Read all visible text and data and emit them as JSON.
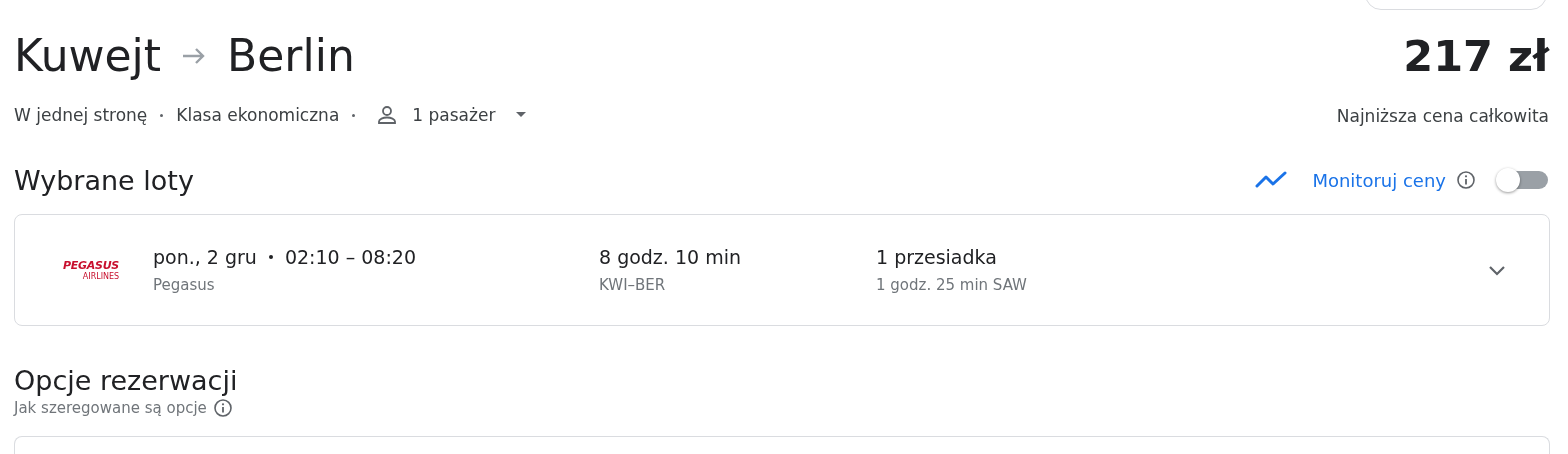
{
  "trip": {
    "origin": "Kuwejt",
    "destination": "Berlin",
    "price": "217 zł",
    "price_note": "Najniższa cena całkowita",
    "options": [
      "W jednej stronę",
      "Klasa ekonomiczna"
    ],
    "passengers": "1 pasażer"
  },
  "selected_flights": {
    "title": "Wybrane loty",
    "track_prices": {
      "label": "Monitoruj ceny",
      "on": false
    }
  },
  "flights": [
    {
      "logo": "PEGASUS",
      "logo_sub": "AIRLINES",
      "date": "pon., 2 gru",
      "times": "02:10 – 08:20",
      "airline": "Pegasus",
      "duration": "8 godz. 10 min",
      "route": "KWI–BER",
      "stops": "1 przesiadka",
      "layover": "1 godz. 25 min SAW",
      "expanded": false
    }
  ],
  "booking": {
    "title": "Opcje rezerwacji",
    "subtitle": "Jak szeregowane są opcje"
  }
}
